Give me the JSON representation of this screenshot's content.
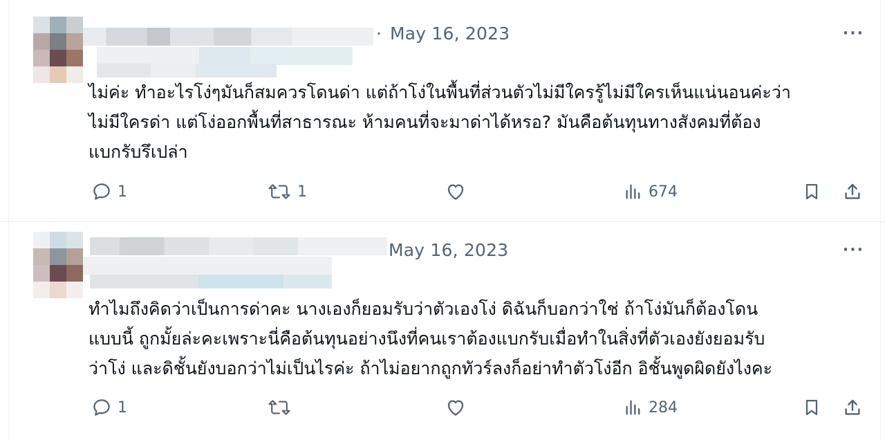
{
  "tweets": [
    {
      "separator": "·",
      "date": "May 16, 2023",
      "more": "···",
      "lines": [
        "ไม่ค่ะ ทำอะไรโง่ๆมันก็สมควรโดนด่า แต่ถ้าโง่ในพื้นที่ส่วนตัวไม่มีใครรู้ไม่มีใครเห็นแน่นอนค่ะว่า",
        "ไม่มีใครด่า แต่โง่ออกพื้นที่สาธารณะ ห้ามคนที่จะมาด่าได้หรอ?  มันคือต้นทุนทางสังคมที่ต้อง",
        "แบกรับรึเปล่า"
      ],
      "replies": "1",
      "retweets": "1",
      "likes": "",
      "views": "674"
    },
    {
      "separator": "",
      "date": "May 16, 2023",
      "more": "···",
      "lines": [
        "ทำไมถึงคิดว่าเป็นการด่าคะ นางเองก็ยอมรับว่าตัวเองโง่ ดิฉันก็บอกว่าใช่ ถ้าโง่มันก็ต้องโดน",
        "แบบนี้ ถูกมั้ยล่ะคะเพราะนี่คือต้นทุนอย่างนึงที่คนเราต้องแบกรับเมื่อทำในสิ่งที่ตัวเองยังยอมรับ",
        "ว่าโง่ และดิชั้นยังบอกว่าไม่เป็นไรค่ะ ถ้าไม่อยากถูกทัวร์ลงก็อย่าทำตัวโง่อีก อิชั้นพูดผิดยังไงคะ"
      ],
      "replies": "1",
      "retweets": "",
      "likes": "",
      "views": "284"
    }
  ],
  "icons": [
    "reply-icon",
    "retweet-icon",
    "like-icon",
    "views-icon",
    "bookmark-icon",
    "share-icon",
    "more-icon"
  ],
  "colors": {
    "text": "#0f1419",
    "muted": "#536471",
    "divider": "#e6e8ea"
  }
}
